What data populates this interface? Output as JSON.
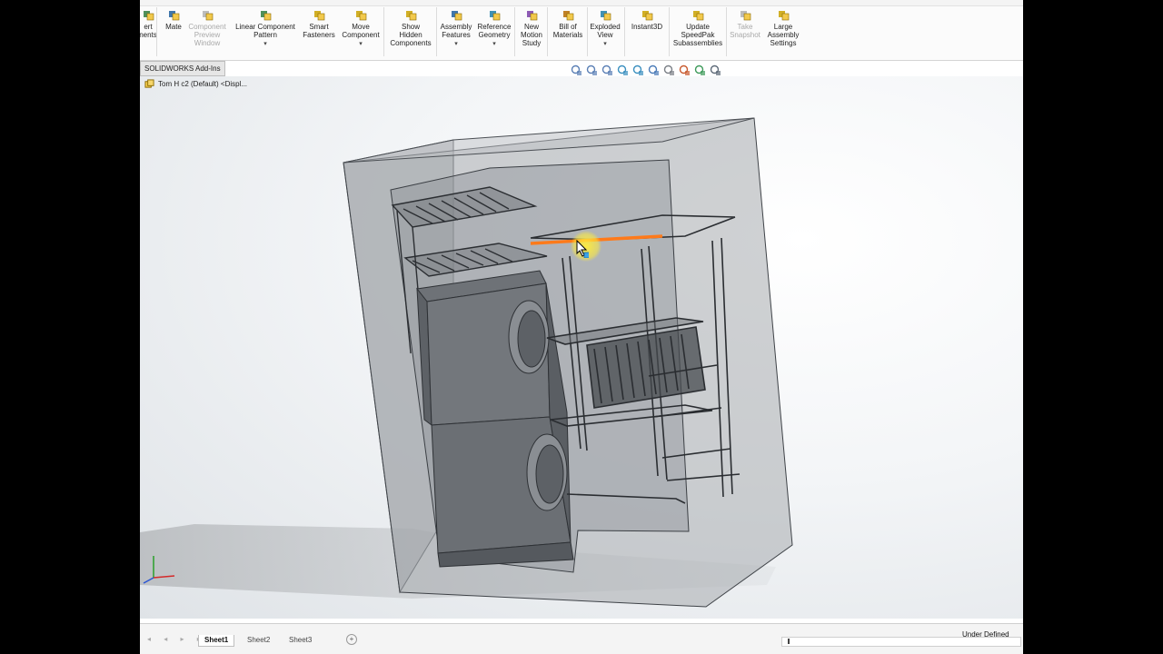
{
  "ribbon": {
    "buttons": [
      {
        "label": "ert\nnents",
        "icon": "insert-components-icon",
        "enabled": true,
        "dropdown": false
      },
      {
        "label": "Mate",
        "icon": "mate-icon",
        "enabled": true,
        "dropdown": false
      },
      {
        "label": "Component\nPreview\nWindow",
        "icon": "component-preview-icon",
        "enabled": false,
        "dropdown": false
      },
      {
        "label": "Linear Component\nPattern",
        "icon": "linear-pattern-icon",
        "enabled": true,
        "dropdown": true
      },
      {
        "label": "Smart\nFasteners",
        "icon": "smart-fasteners-icon",
        "enabled": true,
        "dropdown": false
      },
      {
        "label": "Move\nComponent",
        "icon": "move-component-icon",
        "enabled": true,
        "dropdown": true
      },
      {
        "label": "Show\nHidden\nComponents",
        "icon": "show-hidden-icon",
        "enabled": true,
        "dropdown": false
      },
      {
        "label": "Assembly\nFeatures",
        "icon": "assembly-features-icon",
        "enabled": true,
        "dropdown": true
      },
      {
        "label": "Reference\nGeometry",
        "icon": "reference-geometry-icon",
        "enabled": true,
        "dropdown": true
      },
      {
        "label": "New\nMotion\nStudy",
        "icon": "motion-study-icon",
        "enabled": true,
        "dropdown": false
      },
      {
        "label": "Bill of\nMaterials",
        "icon": "bill-of-materials-icon",
        "enabled": true,
        "dropdown": false
      },
      {
        "label": "Exploded\nView",
        "icon": "exploded-view-icon",
        "enabled": true,
        "dropdown": true
      },
      {
        "label": "Instant3D",
        "icon": "instant3d-icon",
        "enabled": true,
        "dropdown": false
      },
      {
        "label": "Update\nSpeedPak\nSubassemblies",
        "icon": "speedpak-icon",
        "enabled": true,
        "dropdown": false
      },
      {
        "label": "Take\nSnapshot",
        "icon": "camera-icon",
        "enabled": false,
        "dropdown": false
      },
      {
        "label": "Large\nAssembly\nSettings",
        "icon": "large-assembly-icon",
        "enabled": true,
        "dropdown": false
      }
    ]
  },
  "tabs": {
    "addins": "SOLIDWORKS Add-Ins"
  },
  "tree": {
    "root_label": "Tom H c2 (Default) <Displ..."
  },
  "heads_up_toolbar": [
    "zoom-to-fit-icon",
    "zoom-to-area-icon",
    "previous-view-icon",
    "section-view-icon",
    "view-orientation-icon",
    "display-style-icon",
    "hide-show-items-icon",
    "edit-appearance-icon",
    "apply-scene-icon",
    "view-settings-icon"
  ],
  "colors": {
    "accent": "#f7931e",
    "selection": "#ff7a1a",
    "cursor_highlight": "#ffe93c"
  },
  "sheets": [
    {
      "label": "Sheet1",
      "active": true
    },
    {
      "label": "Sheet2",
      "active": false
    },
    {
      "label": "Sheet3",
      "active": false
    }
  ],
  "status": {
    "text": "Under Defined"
  }
}
